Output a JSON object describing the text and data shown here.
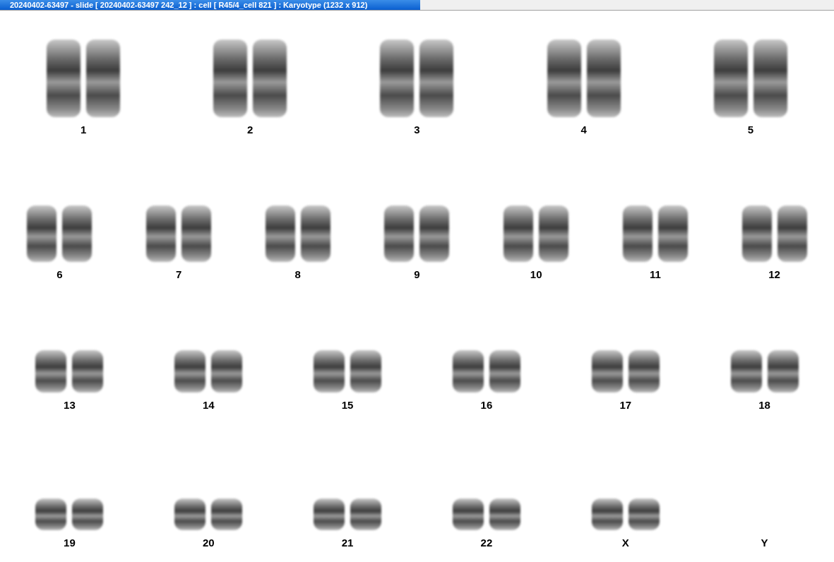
{
  "window": {
    "title": "20240402-63497 - slide [ 20240402-63497 242_12 ] : cell [ R45/4_cell 821 ] : Karyotype  (1232 x 912)"
  },
  "rows": [
    {
      "items": [
        {
          "label": "1",
          "kind": "pair"
        },
        {
          "label": "2",
          "kind": "pair"
        },
        {
          "label": "3",
          "kind": "pair"
        },
        {
          "label": "4",
          "kind": "pair"
        },
        {
          "label": "5",
          "kind": "pair"
        }
      ]
    },
    {
      "items": [
        {
          "label": "6",
          "kind": "pair"
        },
        {
          "label": "7",
          "kind": "pair"
        },
        {
          "label": "8",
          "kind": "pair"
        },
        {
          "label": "9",
          "kind": "pair"
        },
        {
          "label": "10",
          "kind": "pair"
        },
        {
          "label": "11",
          "kind": "pair"
        },
        {
          "label": "12",
          "kind": "pair"
        }
      ]
    },
    {
      "items": [
        {
          "label": "13",
          "kind": "pair"
        },
        {
          "label": "14",
          "kind": "pair"
        },
        {
          "label": "15",
          "kind": "pair"
        },
        {
          "label": "16",
          "kind": "pair"
        },
        {
          "label": "17",
          "kind": "pair"
        },
        {
          "label": "18",
          "kind": "pair"
        }
      ]
    },
    {
      "items": [
        {
          "label": "19",
          "kind": "pair"
        },
        {
          "label": "20",
          "kind": "pair"
        },
        {
          "label": "21",
          "kind": "pair"
        },
        {
          "label": "22",
          "kind": "pair"
        },
        {
          "label": "X",
          "kind": "pair"
        },
        {
          "label": "Y",
          "kind": "empty"
        }
      ]
    }
  ]
}
